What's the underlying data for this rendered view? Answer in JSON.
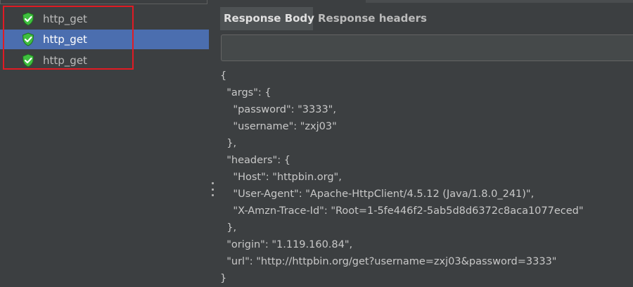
{
  "results_tree": {
    "items": [
      {
        "label": "http_get",
        "status_icon": "check-shield-icon",
        "selected": false
      },
      {
        "label": "http_get",
        "status_icon": "check-shield-icon",
        "selected": true
      },
      {
        "label": "http_get",
        "status_icon": "check-shield-icon",
        "selected": false
      }
    ]
  },
  "tabs": {
    "response_body": "Response Body",
    "response_headers": "Response headers",
    "active": "Response Body"
  },
  "search": {
    "value": "",
    "placeholder": ""
  },
  "response_body": {
    "lines": [
      "{",
      "  \"args\": {",
      "    \"password\": \"3333\",",
      "    \"username\": \"zxj03\"",
      "  },",
      "  \"headers\": {",
      "    \"Host\": \"httpbin.org\",",
      "    \"User-Agent\": \"Apache-HttpClient/4.5.12 (Java/1.8.0_241)\",",
      "    \"X-Amzn-Trace-Id\": \"Root=1-5fe446f2-5ab5d8d6372c8aca1077eced\"",
      "  },",
      "  \"origin\": \"1.119.160.84\",",
      "  \"url\": \"http://httpbin.org/get?username=zxj03&password=3333\"",
      "}"
    ]
  },
  "colors": {
    "background": "#3c3f41",
    "selection": "#4b6eaf",
    "success_icon": "#3fbf3f",
    "annotation_box": "#e01b24"
  }
}
